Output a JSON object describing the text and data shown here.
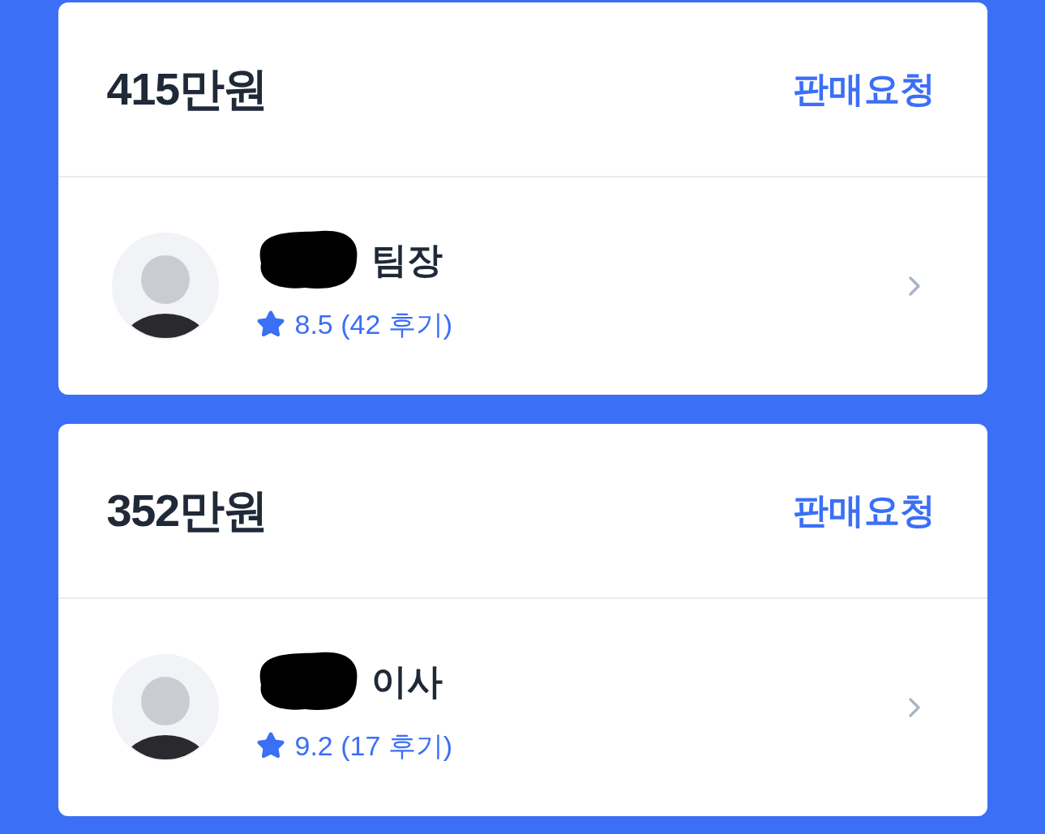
{
  "offers": [
    {
      "price": "415만원",
      "action": "판매요청",
      "seller": {
        "title": "팀장",
        "rating": "8.5 (42 후기)"
      }
    },
    {
      "price": "352만원",
      "action": "판매요청",
      "seller": {
        "title": "이사",
        "rating": "9.2 (17 후기)"
      }
    }
  ]
}
